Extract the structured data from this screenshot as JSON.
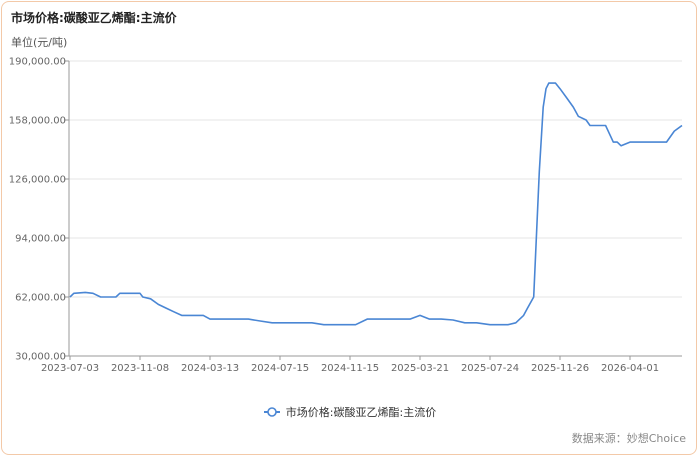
{
  "title": "市场价格:碳酸亚乙烯酯:主流价",
  "unit": "单位(元/吨)",
  "source": "数据来源：妙想Choice",
  "colors": {
    "line": "#4a86d4",
    "grid": "#e6e6e6",
    "axis": "#999999",
    "border": "#f3c9a8"
  },
  "chart_data": {
    "type": "line",
    "title": "市场价格:碳酸亚乙烯酯:主流价",
    "ylabel": "单位(元/吨)",
    "ylim": [
      30000,
      190000
    ],
    "yticks": [
      "190,000.00",
      "158,000.00",
      "126,000.00",
      "94,000.00",
      "62,000.00",
      "30,000.00"
    ],
    "ytick_values": [
      190000,
      158000,
      126000,
      94000,
      62000,
      30000
    ],
    "xticks": [
      "2023-07-03",
      "2023-11-08",
      "2024-03-13",
      "2024-07-15",
      "2024-11-15",
      "2025-03-21",
      "2025-07-24",
      "2025-11-26",
      "2026-04-01"
    ],
    "grid": true,
    "legend": "bottom-center",
    "series": [
      {
        "name": "市场价格:碳酸亚乙烯酯:主流价",
        "x": [
          "2023-07-03",
          "2023-07-10",
          "2023-07-31",
          "2023-08-14",
          "2023-08-28",
          "2023-09-25",
          "2023-10-02",
          "2023-10-23",
          "2023-11-08",
          "2023-11-13",
          "2023-11-27",
          "2023-12-11",
          "2023-12-25",
          "2024-01-08",
          "2024-01-22",
          "2024-02-12",
          "2024-03-01",
          "2024-03-13",
          "2024-03-25",
          "2024-04-08",
          "2024-04-22",
          "2024-05-06",
          "2024-05-20",
          "2024-06-10",
          "2024-07-01",
          "2024-07-15",
          "2024-07-29",
          "2024-08-19",
          "2024-09-09",
          "2024-09-30",
          "2024-10-21",
          "2024-11-15",
          "2024-11-25",
          "2024-12-16",
          "2025-01-06",
          "2025-01-27",
          "2025-02-17",
          "2025-03-03",
          "2025-03-21",
          "2025-04-07",
          "2025-04-28",
          "2025-05-19",
          "2025-06-09",
          "2025-06-30",
          "2025-07-24",
          "2025-08-11",
          "2025-08-25",
          "2025-09-08",
          "2025-09-22",
          "2025-09-29",
          "2025-10-10",
          "2025-10-20",
          "2025-10-27",
          "2025-11-01",
          "2025-11-06",
          "2025-11-12",
          "2025-11-18",
          "2025-11-26",
          "2025-12-08",
          "2025-12-20",
          "2025-12-29",
          "2026-01-12",
          "2026-01-19",
          "2026-02-02",
          "2026-02-16",
          "2026-03-02",
          "2026-03-09",
          "2026-03-16",
          "2026-04-01",
          "2026-04-20",
          "2026-05-04",
          "2026-05-11",
          "2026-05-18"
        ],
        "values": [
          62000,
          64000,
          64500,
          64000,
          62000,
          62000,
          64000,
          64000,
          64000,
          62000,
          61000,
          58000,
          56000,
          54000,
          52000,
          52000,
          52000,
          50000,
          50000,
          50000,
          50000,
          50000,
          50000,
          49000,
          48000,
          48000,
          48000,
          48000,
          48000,
          47000,
          47000,
          47000,
          47000,
          50000,
          50000,
          50000,
          50000,
          50000,
          52000,
          50000,
          50000,
          49500,
          48000,
          48000,
          47000,
          47000,
          47000,
          48000,
          52000,
          56000,
          62000,
          130000,
          165000,
          175000,
          178000,
          178000,
          178000,
          175000,
          170000,
          165000,
          160000,
          158000,
          155000,
          155000,
          155000,
          146000,
          146000,
          144000,
          146000,
          146000,
          146000,
          152000,
          155000
        ]
      }
    ]
  }
}
